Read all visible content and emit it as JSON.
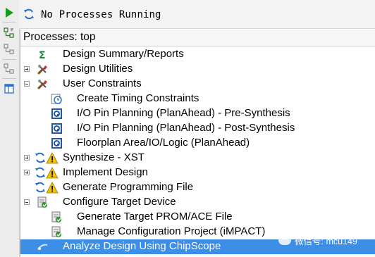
{
  "status": {
    "text": "No Processes Running"
  },
  "panel": {
    "title": "Processes: top"
  },
  "tree": [
    {
      "label": "Design Summary/Reports",
      "icon": "sigma-icon",
      "expander": "none",
      "indent": 0
    },
    {
      "label": "Design Utilities",
      "icon": "tools-icon",
      "expander": "plus",
      "indent": 0
    },
    {
      "label": "User Constraints",
      "icon": "tools-icon",
      "expander": "minus",
      "indent": 0
    },
    {
      "label": "Create Timing Constraints",
      "icon": "clock-icon",
      "expander": "none",
      "indent": 1
    },
    {
      "label": "I/O Pin Planning (PlanAhead) - Pre-Synthesis",
      "icon": "planahead-icon",
      "expander": "none",
      "indent": 1
    },
    {
      "label": "I/O Pin Planning (PlanAhead) - Post-Synthesis",
      "icon": "planahead-icon",
      "expander": "none",
      "indent": 1
    },
    {
      "label": "Floorplan Area/IO/Logic (PlanAhead)",
      "icon": "planahead-icon",
      "expander": "none",
      "indent": 1
    },
    {
      "label": "Synthesize - XST",
      "icon": "refresh-warning-icon",
      "expander": "plus",
      "indent": 0
    },
    {
      "label": "Implement Design",
      "icon": "refresh-warning-icon",
      "expander": "plus",
      "indent": 0
    },
    {
      "label": "Generate Programming File",
      "icon": "refresh-warning-icon",
      "expander": "none",
      "indent": 0
    },
    {
      "label": "Configure Target Device",
      "icon": "device-icon",
      "expander": "minus",
      "indent": 0
    },
    {
      "label": "Generate Target PROM/ACE File",
      "icon": "device-icon",
      "expander": "none",
      "indent": 1
    },
    {
      "label": "Manage Configuration Project (iMPACT)",
      "icon": "device-icon",
      "expander": "none",
      "indent": 1
    },
    {
      "label": "Analyze Design Using ChipScope",
      "icon": "probe-icon",
      "expander": "none",
      "indent": 0,
      "selected": true
    }
  ],
  "watermark": {
    "text": "微信号: mcu149"
  },
  "colors": {
    "selection": "#3d8ee6",
    "run_green": "#1a9a1a",
    "refresh_blue": "#2a6fc9",
    "warning_yellow": "#f2c200"
  }
}
